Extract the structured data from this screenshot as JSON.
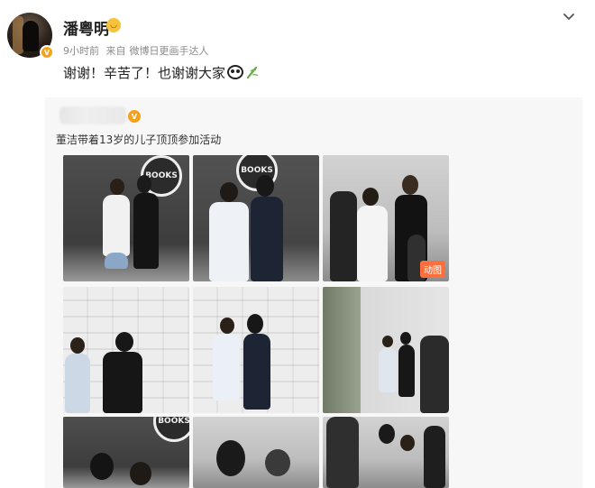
{
  "author": {
    "name": "潘粤明",
    "name_emoji_icon": "smile-face-icon",
    "verified_icon": "verified-badge-icon"
  },
  "post": {
    "time": "9小时前",
    "source_prefix": "来自",
    "source": "微博日更画手达人",
    "text": "谢谢！辛苦了！也谢谢大家",
    "emoji_icons": [
      "panda-icon",
      "bamboo-icon"
    ]
  },
  "repost": {
    "text": "董洁带着13岁的儿子顶顶参加活动",
    "photos_visible": 9,
    "gif_badge": "动图"
  },
  "colors": {
    "accent_orange": "#f6a11b",
    "gif_badge": "#ff6f3d",
    "repost_bg": "#f7f7f7",
    "meta_gray": "#8a8a8a"
  }
}
